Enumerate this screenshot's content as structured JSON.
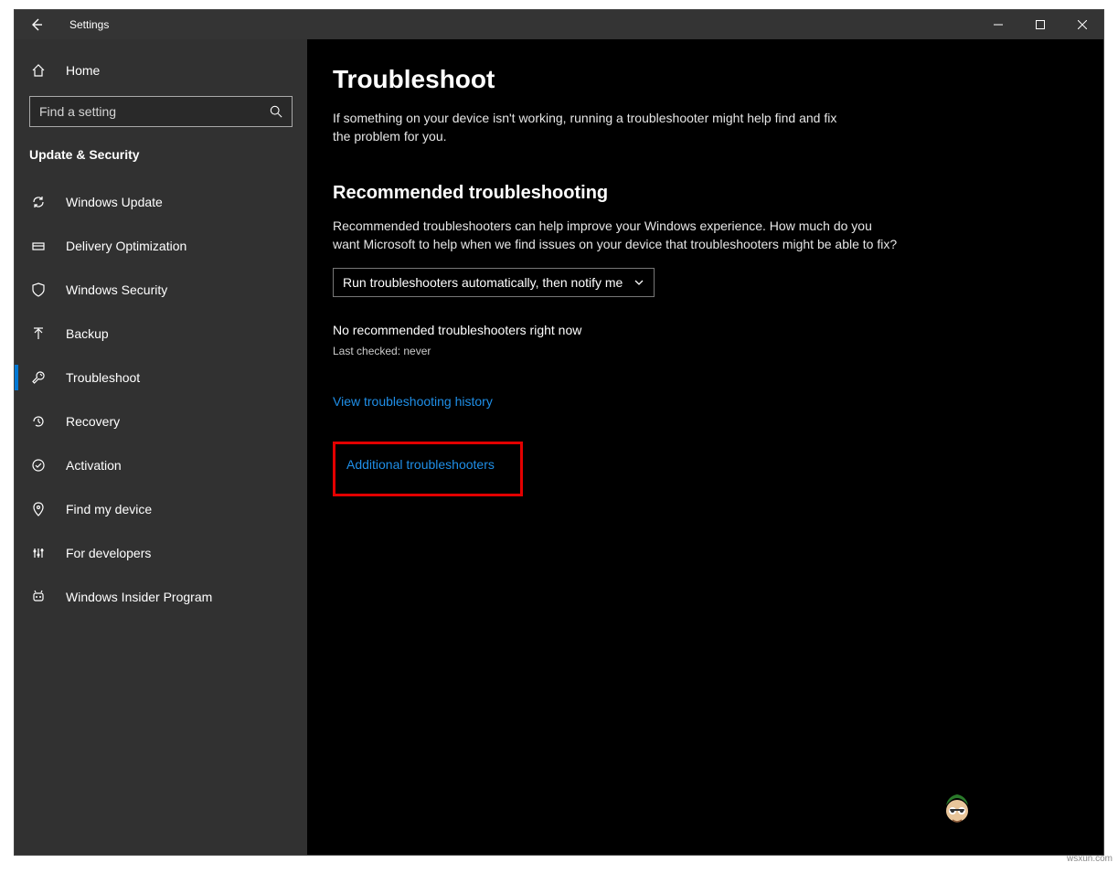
{
  "titlebar": {
    "title": "Settings"
  },
  "sidebar": {
    "home_label": "Home",
    "search_placeholder": "Find a setting",
    "section_title": "Update & Security",
    "items": [
      {
        "label": "Windows Update"
      },
      {
        "label": "Delivery Optimization"
      },
      {
        "label": "Windows Security"
      },
      {
        "label": "Backup"
      },
      {
        "label": "Troubleshoot"
      },
      {
        "label": "Recovery"
      },
      {
        "label": "Activation"
      },
      {
        "label": "Find my device"
      },
      {
        "label": "For developers"
      },
      {
        "label": "Windows Insider Program"
      }
    ]
  },
  "main": {
    "title": "Troubleshoot",
    "description": "If something on your device isn't working, running a troubleshooter might help find and fix the problem for you.",
    "rec_heading": "Recommended troubleshooting",
    "rec_description": "Recommended troubleshooters can help improve your Windows experience. How much do you want Microsoft to help when we find issues on your device that troubleshooters might be able to fix?",
    "dropdown_value": "Run troubleshooters automatically, then notify me",
    "status_text": "No recommended troubleshooters right now",
    "last_checked": "Last checked: never",
    "link_history": "View troubleshooting history",
    "link_additional": "Additional troubleshooters"
  },
  "watermark": "wsxun.com"
}
